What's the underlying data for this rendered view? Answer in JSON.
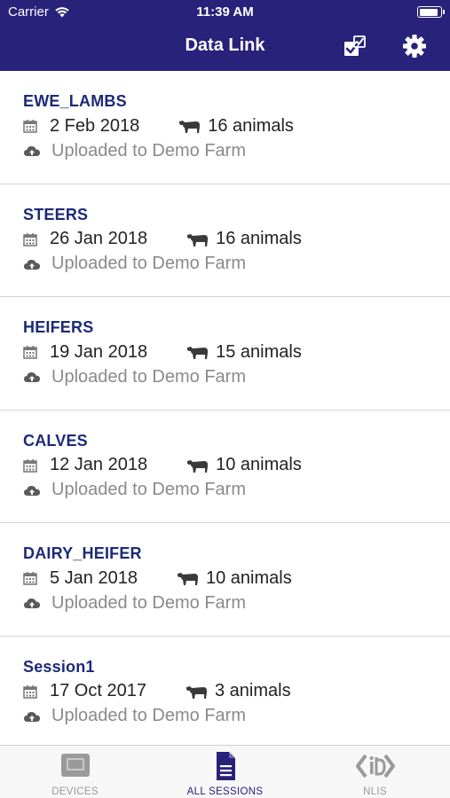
{
  "status_bar": {
    "carrier": "Carrier",
    "time": "11:39 AM",
    "battery_level": 0.95
  },
  "nav": {
    "title": "Data Link",
    "check_icon": "checklist-icon",
    "settings_icon": "gear-icon"
  },
  "colors": {
    "header": "#28227a",
    "title": "#1c2a78",
    "muted": "#8a8a8a"
  },
  "sessions": [
    {
      "name": "EWE_LAMBS",
      "date": "2 Feb 2018",
      "animals": "16 animals",
      "status": "Uploaded to Demo Farm"
    },
    {
      "name": "STEERS",
      "date": "26 Jan 2018",
      "animals": "16 animals",
      "status": "Uploaded to Demo Farm"
    },
    {
      "name": "HEIFERS",
      "date": "19 Jan 2018",
      "animals": "15 animals",
      "status": "Uploaded to Demo Farm"
    },
    {
      "name": "CALVES",
      "date": "12 Jan 2018",
      "animals": "10 animals",
      "status": "Uploaded to Demo Farm"
    },
    {
      "name": "DAIRY_HEIFER",
      "date": "5 Jan 2018",
      "animals": "10 animals",
      "status": "Uploaded to Demo Farm"
    },
    {
      "name": "Session1",
      "date": "17 Oct 2017",
      "animals": "3 animals",
      "status": "Uploaded to Demo Farm"
    }
  ],
  "tabs": [
    {
      "label": "DEVICES",
      "icon": "device-icon",
      "active": false
    },
    {
      "label": "ALL SESSIONS",
      "icon": "document-icon",
      "active": true
    },
    {
      "label": "NLIS",
      "icon": "nlis-logo-icon",
      "active": false
    }
  ]
}
